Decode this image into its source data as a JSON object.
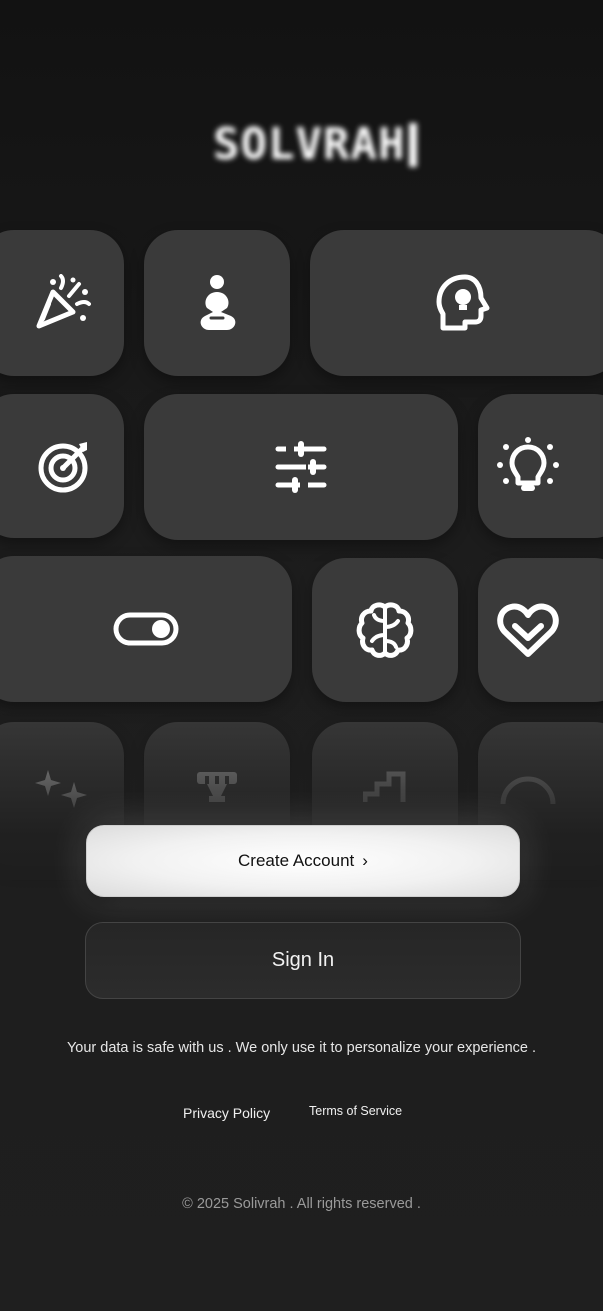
{
  "brand": {
    "logo_text": "SOLVRAH"
  },
  "icons": {
    "row1": [
      "party-popper-icon",
      "meditation-person-icon",
      "head-lightbulb-icon"
    ],
    "row2": [
      "target-dart-icon",
      "sliders-icon",
      "lightbulb-icon"
    ],
    "row3": [
      "toggle-switch-icon",
      "brain-icon",
      "heart-check-icon"
    ],
    "row4": [
      "sparkles-icon",
      "trophy-icon",
      "stairs-icon",
      "circle-icon"
    ]
  },
  "actions": {
    "create_account_label": "Create Account",
    "create_account_chevron": "›",
    "sign_in_label": "Sign In"
  },
  "notice": {
    "text": "Your data is safe with us . We only use it to personalize your experience ."
  },
  "footer_links": {
    "privacy_policy": "Privacy Policy",
    "terms_of_service": "Terms of Service"
  },
  "copyright": {
    "text": "© 2025 Solivrah . All rights reserved ."
  },
  "colors": {
    "background": "#1e1e1e",
    "tile": "#3a3a3a",
    "icon": "#ffffff",
    "primary_button": "#f1f1f1",
    "secondary_button_border": "#444444",
    "muted_text": "#9a9a9a"
  }
}
